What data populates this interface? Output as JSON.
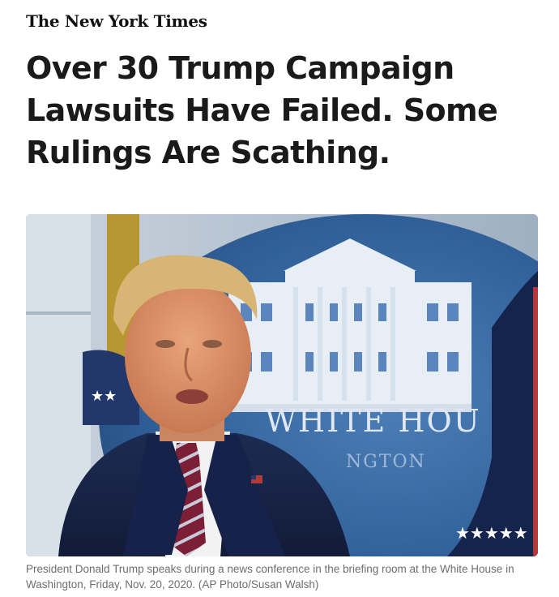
{
  "masthead": {
    "logo_text": "The New York Times"
  },
  "article": {
    "headline": "Over 30 Trump Campaign Lawsuits Have Failed. Some Rulings Are Scathing.",
    "photo": {
      "backdrop_text_line1": "WHITE HOU",
      "backdrop_text_line2": "NGTON"
    },
    "caption": "President Donald Trump speaks during a news conference in the briefing room at the White House in Washington, Friday, Nov. 20, 2020. (AP Photo/Susan Walsh)"
  }
}
